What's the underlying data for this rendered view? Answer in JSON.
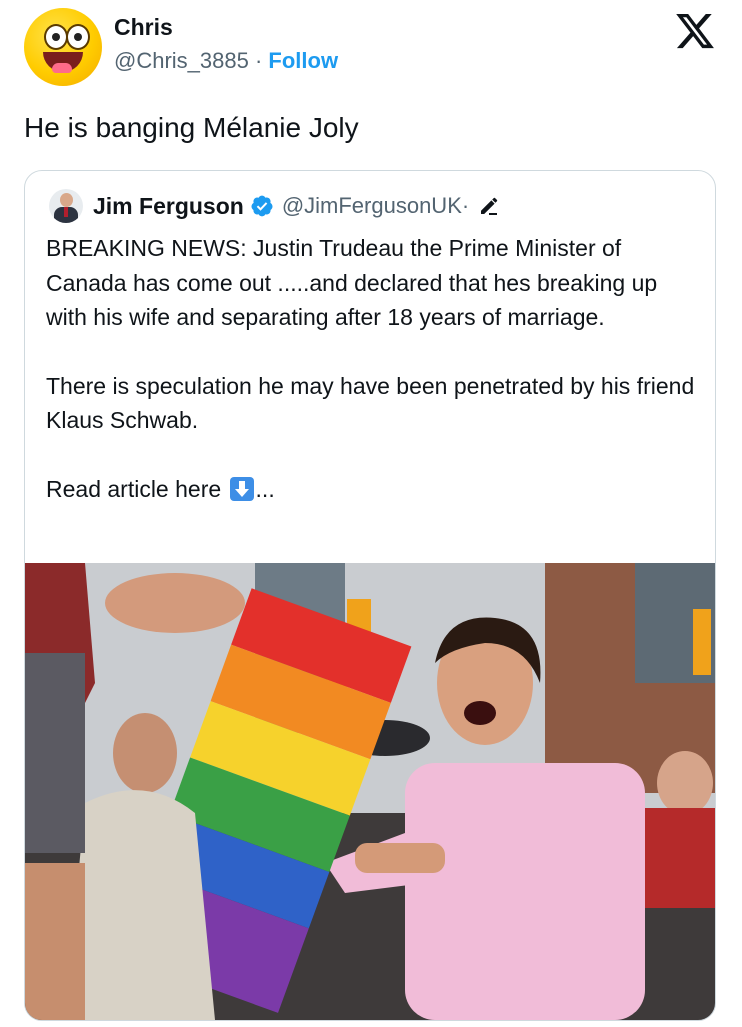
{
  "author": {
    "name": "Chris",
    "handle": "@Chris_3885",
    "separator": " · ",
    "follow_label": "Follow",
    "avatar_icon": "grinning-emoji-avatar"
  },
  "tweet": {
    "text": "He is banging Mélanie Joly"
  },
  "platform_icon": "x-logo-icon",
  "quoted_tweet": {
    "name": "Jim Ferguson",
    "verified": true,
    "handle": "@JimFergusonUK",
    "separator": " ·",
    "edited_icon": "pencil-icon",
    "paragraph_1": "BREAKING NEWS: Justin Trudeau the Prime Minister of Canada has come out .....and declared that hes breaking up with his wife and separating after 18 years of marriage.",
    "paragraph_2": "There is speculation he may have been penetrated by his friend Klaus Schwab.",
    "read_more_prefix": "Read article here ",
    "read_more_suffix": "...",
    "read_more_icon": "down-arrow-emoji-icon"
  },
  "colors": {
    "accent": "#1d9bf0",
    "text": "#0f1419",
    "secondary_text": "#536471",
    "border": "#cfd9de"
  }
}
